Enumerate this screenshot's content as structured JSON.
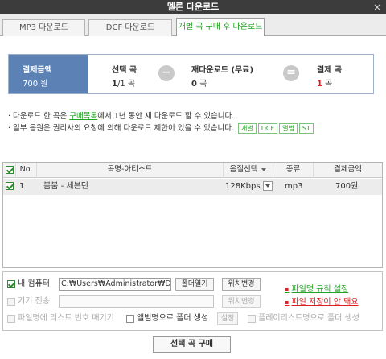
{
  "window": {
    "title": "멜론 다운로드",
    "close": "×"
  },
  "tabs": [
    {
      "label": "MP3 다운로드",
      "active": false
    },
    {
      "label": "DCF 다운로드",
      "active": false
    },
    {
      "label": "개별 곡 구매 후 다운로드",
      "active": true
    }
  ],
  "summary": {
    "payment": {
      "label": "결제금액",
      "value": "700 원"
    },
    "selected": {
      "label": "선택 곡",
      "count": "1",
      "rest": "/1 곡"
    },
    "minus": "−",
    "redownload": {
      "label": "재다운로드 (무료)",
      "count": "0",
      "unit": " 곡"
    },
    "equals": "=",
    "pay_songs": {
      "label": "결제 곡",
      "count": "1",
      "unit": " 곡"
    }
  },
  "notes": {
    "line1_pre": "· 다운로드 한 곡은 ",
    "line1_link": "구매목록",
    "line1_post": "에서 1년 동안 재 다운로드 할 수 있습니다.",
    "line2": "· 일부 음원은 권리사의 요청에 의해 다운로드 제한이 있을 수 있습니다.",
    "tags": [
      "개별",
      "DCF",
      "앨범",
      "ST"
    ]
  },
  "table": {
    "headers": {
      "no": "No.",
      "title": "곡명-아티스트",
      "quality": "음질선택",
      "type": "종류",
      "price": "결제금액"
    },
    "rows": [
      {
        "no": "1",
        "title": "붐붐 - 세븐틴",
        "quality": "128Kbps",
        "type": "mp3",
        "price": "700원",
        "checked": true
      }
    ]
  },
  "options": {
    "my_computer": {
      "label": "내 컴퓨터",
      "path": "C:₩Users₩Administrator₩Do",
      "open_btn": "폴더열기",
      "change_btn": "위치변경"
    },
    "device": {
      "label": "기기 전송",
      "path": "",
      "change_btn": "위치변경"
    },
    "numbering": {
      "label": "파일명에 리스트 번호 매기기"
    },
    "album_folder": {
      "label": "앨범명으로 폴더 생성",
      "setting_btn": "설정"
    },
    "playlist_folder": {
      "label": "플레이리스트명으로 폴더 생성"
    },
    "links": {
      "filename_rule": "파일명 규칙 설정",
      "save_issue": "파일 저장이 안 돼요"
    }
  },
  "buy_button": "선택 곡 구매",
  "colors": {
    "summary_blue": "#5b81b5",
    "accent_green": "#23a323",
    "accent_red": "#e02020"
  }
}
